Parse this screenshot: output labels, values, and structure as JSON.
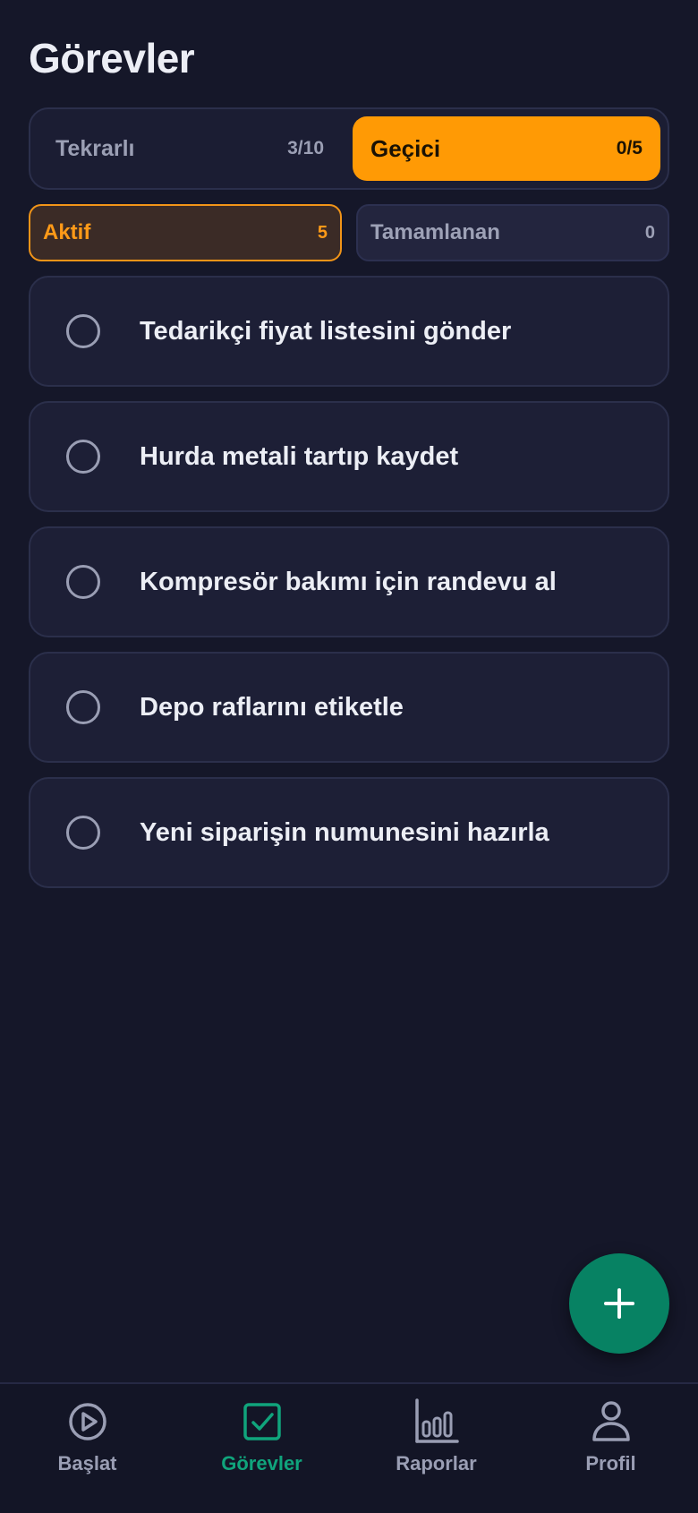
{
  "page": {
    "title": "Görevler"
  },
  "segment": {
    "options": [
      {
        "label": "Tekrarlı",
        "count": "3/10",
        "selected": false
      },
      {
        "label": "Geçici",
        "count": "0/5",
        "selected": true
      }
    ]
  },
  "filters": [
    {
      "label": "Aktif",
      "count": "5",
      "selected": true
    },
    {
      "label": "Tamamlanan",
      "count": "0",
      "selected": false
    }
  ],
  "tasks": [
    {
      "text": "Tedarikçi fiyat listesini gönder",
      "done": false
    },
    {
      "text": "Hurda metali tartıp kaydet",
      "done": false
    },
    {
      "text": "Kompresör bakımı için randevu al",
      "done": false
    },
    {
      "text": "Depo raflarını etiketle",
      "done": false
    },
    {
      "text": "Yeni siparişin numunesini hazırla",
      "done": false
    }
  ],
  "fab": {
    "icon": "plus-icon"
  },
  "bottom_nav": {
    "items": [
      {
        "label": "Başlat",
        "icon": "play-circle-icon",
        "selected": false
      },
      {
        "label": "Görevler",
        "icon": "checkbox-icon",
        "selected": true
      },
      {
        "label": "Raporlar",
        "icon": "bar-chart-icon",
        "selected": false
      },
      {
        "label": "Profil",
        "icon": "person-icon",
        "selected": false
      }
    ]
  },
  "colors": {
    "background": "#151729",
    "accent_orange": "#ff9a05",
    "accent_green": "#078263",
    "nav_selected": "#10a47c"
  }
}
